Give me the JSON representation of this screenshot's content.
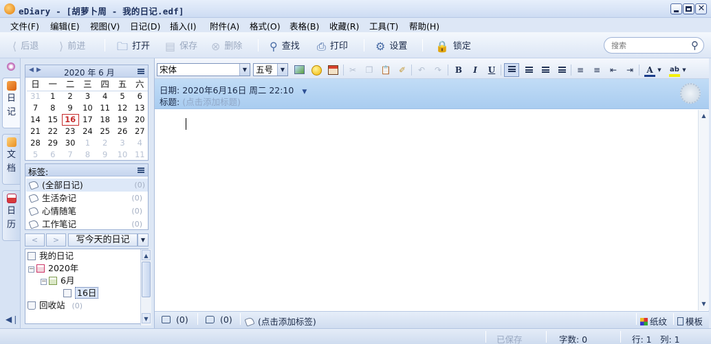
{
  "window": {
    "title": "eDiary - [胡萝卜周 - 我的日记.edf]",
    "minimize_label": "_",
    "maximize_label": "□",
    "close_label": "✕"
  },
  "menu": [
    "文件(F)",
    "编辑(E)",
    "视图(V)",
    "日记(D)",
    "插入(I)",
    "附件(A)",
    "格式(O)",
    "表格(B)",
    "收藏(R)",
    "工具(T)",
    "帮助(H)"
  ],
  "toolbar": {
    "back": "后退",
    "forward": "前进",
    "open": "打开",
    "save": "保存",
    "delete": "删除",
    "find": "查找",
    "print": "打印",
    "settings": "设置",
    "lock": "锁定",
    "search_placeholder": "搜索"
  },
  "sidetabs": [
    {
      "label": "日记",
      "active": true
    },
    {
      "label": "文档",
      "active": false
    },
    {
      "label": "日历",
      "active": false
    }
  ],
  "calendar": {
    "title": "2020 年 6 月",
    "weekdays": [
      "日",
      "一",
      "二",
      "三",
      "四",
      "五",
      "六"
    ],
    "weeks": [
      [
        "31",
        "1",
        "2",
        "3",
        "4",
        "5",
        "6"
      ],
      [
        "7",
        "8",
        "9",
        "10",
        "11",
        "12",
        "13"
      ],
      [
        "14",
        "15",
        "16",
        "17",
        "18",
        "19",
        "20"
      ],
      [
        "21",
        "22",
        "23",
        "24",
        "25",
        "26",
        "27"
      ],
      [
        "28",
        "29",
        "30",
        "1",
        "2",
        "3",
        "4"
      ],
      [
        "5",
        "6",
        "7",
        "8",
        "9",
        "10",
        "11"
      ]
    ],
    "today": "16"
  },
  "tags": {
    "header": "标签:",
    "items": [
      {
        "label": "(全部日记)",
        "count": "(0)"
      },
      {
        "label": "生活杂记",
        "count": "(0)"
      },
      {
        "label": "心情随笔",
        "count": "(0)"
      },
      {
        "label": "工作笔记",
        "count": "(0)"
      }
    ]
  },
  "nav": {
    "prev": "<",
    "next": ">",
    "write_today": "写今天的日记",
    "dropdown": "▼"
  },
  "tree": {
    "root": "我的日记",
    "year": "2020年",
    "month": "6月",
    "day": "16日",
    "recycle": "回收站",
    "recycle_count": "(0)"
  },
  "format": {
    "font": "宋体",
    "size": "五号"
  },
  "entry": {
    "date_label": "日期:",
    "date_value": "2020年6月16日 周二 22:10",
    "title_label": "标题:",
    "title_placeholder": "(点击添加标题)"
  },
  "entry_status": {
    "attachments": "(0)",
    "comments": "(0)",
    "tags": "(点击添加标签)",
    "paper": "纸纹",
    "template": "模板"
  },
  "statusbar": {
    "saved": "已保存",
    "word_count": "字数: 0",
    "line": "行: 1",
    "column": "列: 1"
  }
}
